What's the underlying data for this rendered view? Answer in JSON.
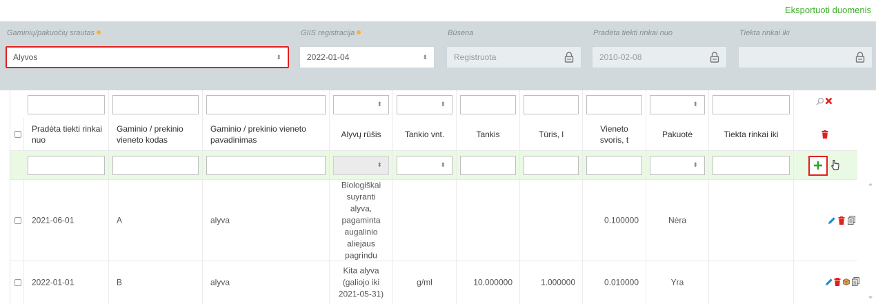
{
  "toolbar": {
    "export_label": "Eksportuoti duomenis"
  },
  "filters": {
    "stream": {
      "label": "Gaminių/pakuočių srautas",
      "value": "Alyvos"
    },
    "giis": {
      "label": "GIIS registracija",
      "value": "2022-01-04"
    },
    "status": {
      "label": "Būsena",
      "value": "Registruota"
    },
    "start": {
      "label": "Pradėta tiekti rinkai nuo",
      "value": "2010-02-08"
    },
    "end": {
      "label": "Tiekta rinkai iki",
      "value": ""
    }
  },
  "table": {
    "headers": {
      "start": "Pradėta tiekti rinkai nuo",
      "code": "Gaminio / prekinio vieneto kodas",
      "name": "Gaminio / prekinio vieneto pavadinimas",
      "type": "Alyvų rūšis",
      "density_unit": "Tankio vnt.",
      "density": "Tankis",
      "volume": "Tūris, l",
      "unit_weight": "Vieneto svoris, t",
      "package": "Pakuotė",
      "end": "Tiekta rinkai iki"
    },
    "rows": [
      {
        "start": "2021-06-01",
        "code": "A",
        "name": "alyva",
        "type": "Biologiškai suyranti alyva, pagaminta augalinio aliejaus pagrindu",
        "density_unit": "",
        "density": "",
        "volume": "",
        "unit_weight": "0.100000",
        "package": "Nėra",
        "end": ""
      },
      {
        "start": "2022-01-01",
        "code": "B",
        "name": "alyva",
        "type": "Kita alyva (galiojo iki 2021-05-31)",
        "density_unit": "g/ml",
        "density": "10.000000",
        "volume": "1.000000",
        "unit_weight": "0.010000",
        "package": "Yra",
        "end": ""
      }
    ]
  },
  "colors": {
    "accent_green": "#3fae29",
    "delete_red": "#e0201f",
    "edit_blue": "#1a8ccf",
    "highlight_red": "#e0201f",
    "filter_bg": "#d2d9dc",
    "add_row_bg": "#eaf9e3"
  },
  "icons": {
    "search": "search-icon",
    "clear": "close-icon",
    "delete": "trash-icon",
    "edit": "pencil-icon",
    "copy": "copy-icon",
    "package": "box-icon",
    "add": "plus-icon",
    "lock": "lock-icon"
  }
}
